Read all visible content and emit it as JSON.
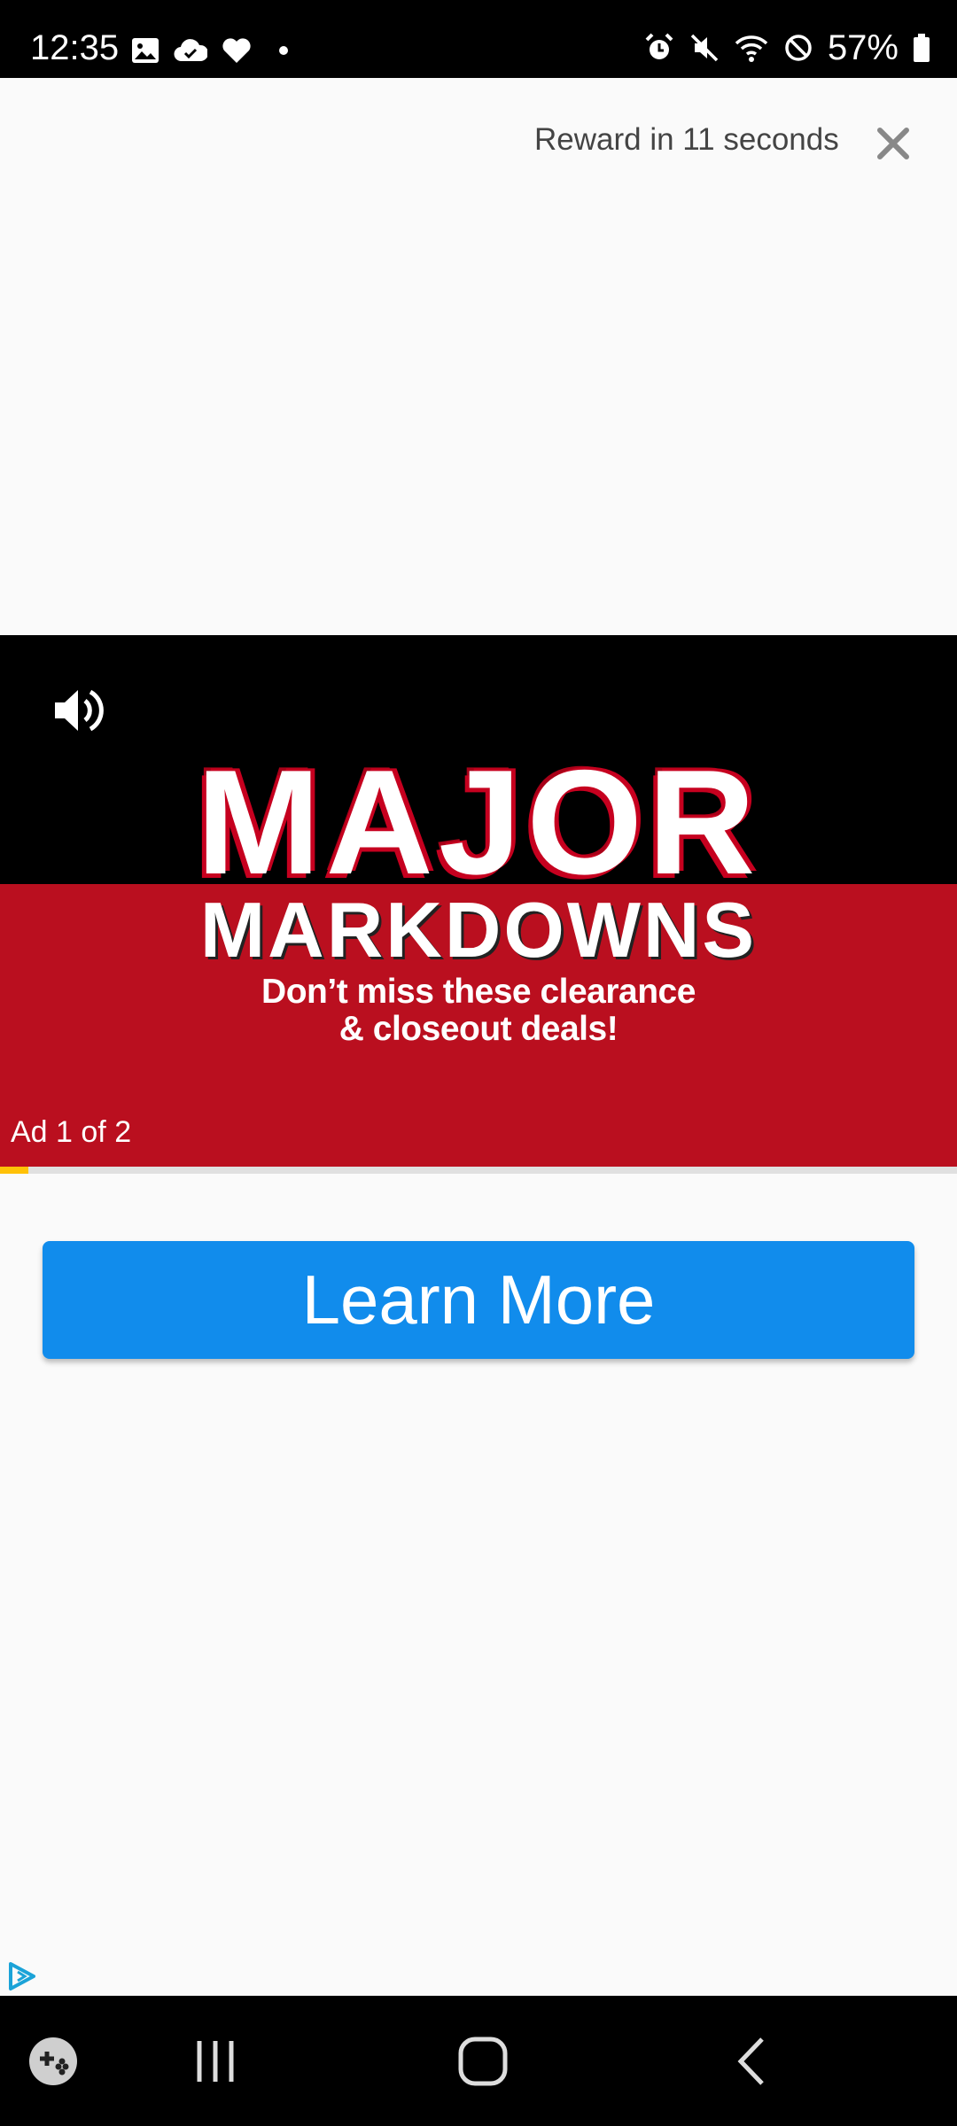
{
  "status_bar": {
    "time": "12:35",
    "battery": "57%",
    "left_icons": [
      "image-icon",
      "cloud-icon",
      "heart-icon",
      "dot-icon"
    ],
    "right_icons": [
      "alarm-icon",
      "mute-icon",
      "wifi-icon",
      "dnd-icon",
      "battery-icon"
    ]
  },
  "header": {
    "reward_text": "Reward in 11 seconds",
    "close_icon": "close-icon"
  },
  "video": {
    "headline_major": "MAJOR",
    "headline_markdowns": "MARKDOWNS",
    "subtitle_line1": "Don’t miss these clearance",
    "subtitle_line2": "& closeout deals!",
    "ad_count": "Ad 1 of 2",
    "progress": 0.03,
    "colors": {
      "top": "#000000",
      "bottom": "#ba0f1f",
      "progress": "#ffc107"
    }
  },
  "cta": {
    "label": "Learn More",
    "color": "#118cec"
  },
  "nav_bar": {
    "icons": [
      "game-launcher-icon",
      "recents-icon",
      "home-icon",
      "back-icon"
    ]
  }
}
